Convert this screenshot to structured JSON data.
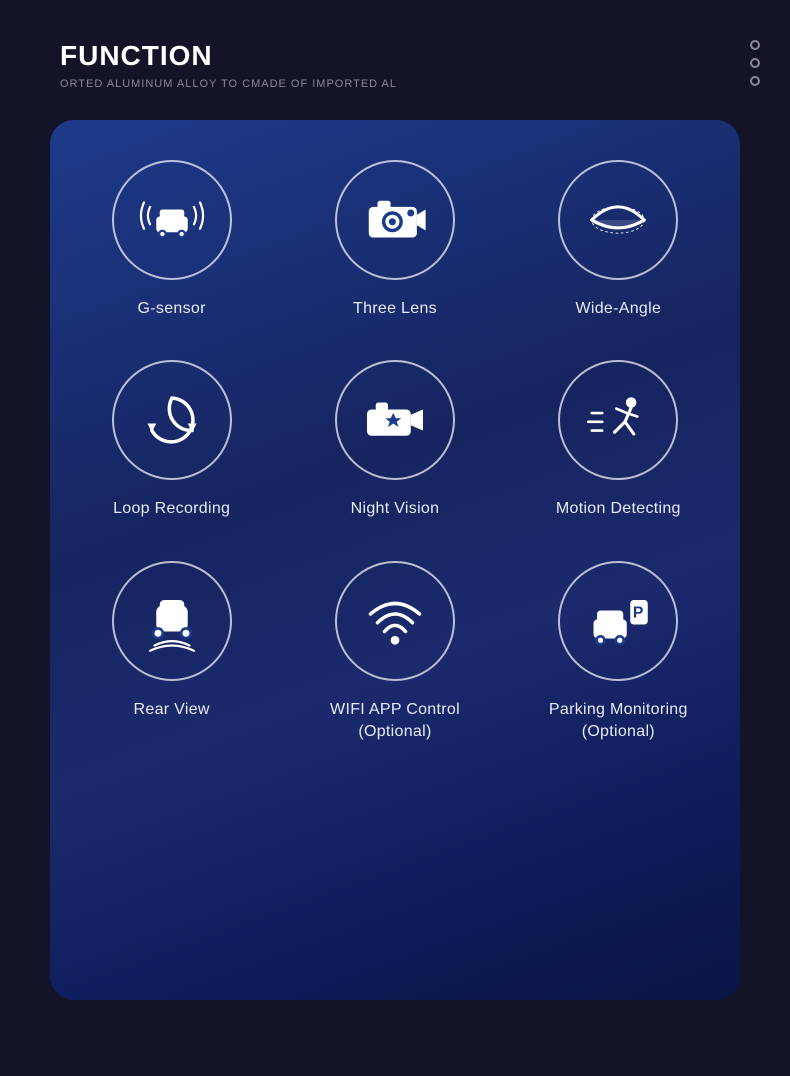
{
  "header": {
    "title": "FUNCTION",
    "subtitle": "ORTED ALUMINUM ALLOY TO CMADE OF IMPORTED AL"
  },
  "features": [
    {
      "id": "g-sensor",
      "label": "G-sensor"
    },
    {
      "id": "three-lens",
      "label": "Three Lens"
    },
    {
      "id": "wide-angle",
      "label": "Wide-Angle"
    },
    {
      "id": "loop-recording",
      "label": "Loop Recording"
    },
    {
      "id": "night-vision",
      "label": "Night Vision"
    },
    {
      "id": "motion-detecting",
      "label": "Motion Detecting"
    },
    {
      "id": "rear-view",
      "label": "Rear View"
    },
    {
      "id": "wifi-app-control",
      "label": "WIFI APP Control\n(Optional)"
    },
    {
      "id": "parking-monitoring",
      "label": "Parking Monitoring\n(Optional)"
    }
  ]
}
